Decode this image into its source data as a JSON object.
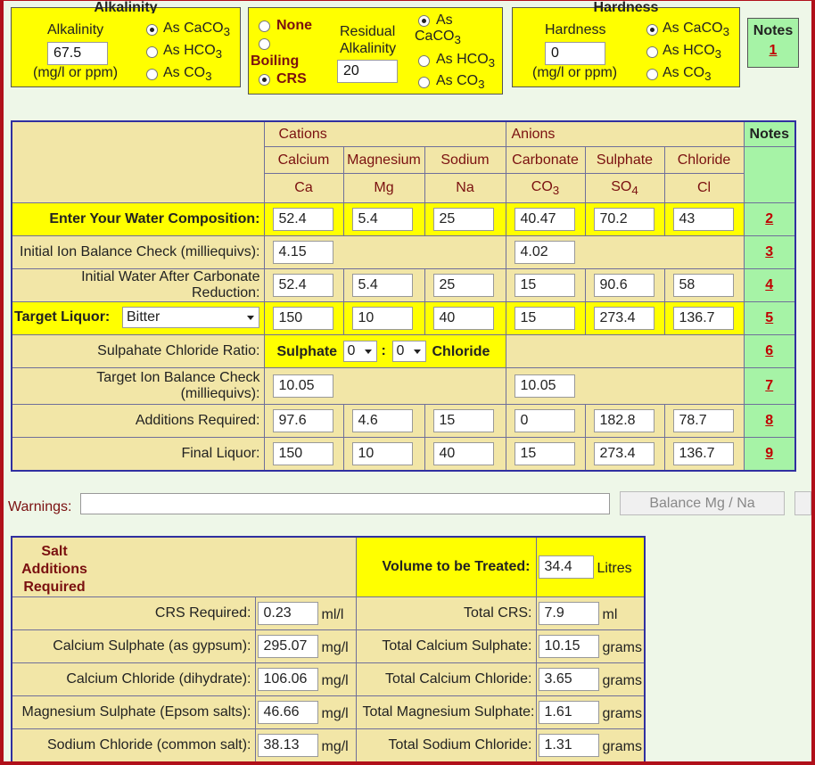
{
  "alkalinity": {
    "caption": "Alkalinity",
    "label": "Alkalinity",
    "value": "67.5",
    "units": "(mg/l or ppm)",
    "options": [
      "As CaCO",
      "As HCO",
      "As CO"
    ],
    "subs": [
      "3",
      "3",
      "3"
    ]
  },
  "residual": {
    "none_label": "None",
    "boiling_label": "Boiling",
    "crs_label": "CRS",
    "title1": "Residual",
    "title2": "Alkalinity",
    "value": "20",
    "opt1a": "As",
    "opt1b": "CaCO",
    "opt1sub": "3",
    "opt2": "As HCO",
    "opt2sub": "3",
    "opt3": "As CO",
    "opt3sub": "3"
  },
  "hardness": {
    "caption": "Hardness",
    "label": "Hardness",
    "value": "0",
    "units": "(mg/l or ppm)",
    "options": [
      "As CaCO",
      "As HCO",
      "As CO"
    ],
    "subs": [
      "3",
      "3",
      "3"
    ]
  },
  "notes_box": {
    "title": "Notes",
    "link": "1"
  },
  "table": {
    "cations_label": "Cations",
    "anions_label": "Anions",
    "notes_label": "Notes",
    "ions": [
      {
        "name": "Calcium",
        "sym": "Ca",
        "sub": ""
      },
      {
        "name": "Magnesium",
        "sym": "Mg",
        "sub": ""
      },
      {
        "name": "Sodium",
        "sym": "Na",
        "sub": ""
      },
      {
        "name": "Carbonate",
        "sym": "CO",
        "sub": "3"
      },
      {
        "name": "Sulphate",
        "sym": "SO",
        "sub": "4"
      },
      {
        "name": "Chloride",
        "sym": "Cl",
        "sub": ""
      }
    ],
    "rows": {
      "composition": {
        "label": "Enter Your Water Composition:",
        "values": [
          "52.4",
          "5.4",
          "25",
          "40.47",
          "70.2",
          "43"
        ],
        "note": "2"
      },
      "balance": {
        "label": "Initial Ion Balance Check (milliequivs):",
        "cation": "4.15",
        "anion": "4.02",
        "note": "3"
      },
      "after": {
        "label1": "Initial Water After Carbonate",
        "label2": "Reduction:",
        "values": [
          "52.4",
          "5.4",
          "25",
          "15",
          "90.6",
          "58"
        ],
        "note": "4"
      },
      "target": {
        "label": "Target Liquor:",
        "select": "Bitter",
        "values": [
          "150",
          "10",
          "40",
          "15",
          "273.4",
          "136.7"
        ],
        "note": "5"
      },
      "ratio": {
        "label": "Sulpahate Chloride Ratio:",
        "sulphate_label": "Sulphate",
        "sel1": "0",
        "colon": ":",
        "sel2": "0",
        "chloride_label": "Chloride",
        "note": "6"
      },
      "target_balance": {
        "label1": "Target Ion Balance Check",
        "label2": "(milliequivs):",
        "cation": "10.05",
        "anion": "10.05",
        "note": "7"
      },
      "additions": {
        "label": "Additions Required:",
        "values": [
          "97.6",
          "4.6",
          "15",
          "0",
          "182.8",
          "78.7"
        ],
        "note": "8"
      },
      "final": {
        "label": "Final Liquor:",
        "values": [
          "150",
          "10",
          "40",
          "15",
          "273.4",
          "136.7"
        ],
        "note": "9"
      }
    }
  },
  "warnings": {
    "label": "Warnings:",
    "value": "",
    "button": "Balance Mg / Na"
  },
  "salts": {
    "title1": "Salt",
    "title2": "Additions",
    "title3": "Required",
    "volume_label": "Volume to be Treated:",
    "volume_value": "34.4",
    "volume_unit": "Litres",
    "rows": [
      {
        "label": "CRS Required:",
        "value": "0.23",
        "unit": "ml/l",
        "total_label": "Total CRS:",
        "total": "7.9",
        "total_unit": "ml"
      },
      {
        "label": "Calcium Sulphate (as gypsum):",
        "value": "295.07",
        "unit": "mg/l",
        "total_label": "Total Calcium Sulphate:",
        "total": "10.15",
        "total_unit": "grams"
      },
      {
        "label": "Calcium Chloride (dihydrate):",
        "value": "106.06",
        "unit": "mg/l",
        "total_label": "Total Calcium Chloride:",
        "total": "3.65",
        "total_unit": "grams"
      },
      {
        "label": "Magnesium Sulphate (Epsom salts):",
        "value": "46.66",
        "unit": "mg/l",
        "total_label": "Total Magnesium Sulphate:",
        "total": "1.61",
        "total_unit": "grams"
      },
      {
        "label": "Sodium Chloride (common salt):",
        "value": "38.13",
        "unit": "mg/l",
        "total_label": "Total Sodium Chloride:",
        "total": "1.31",
        "total_unit": "grams"
      }
    ]
  }
}
